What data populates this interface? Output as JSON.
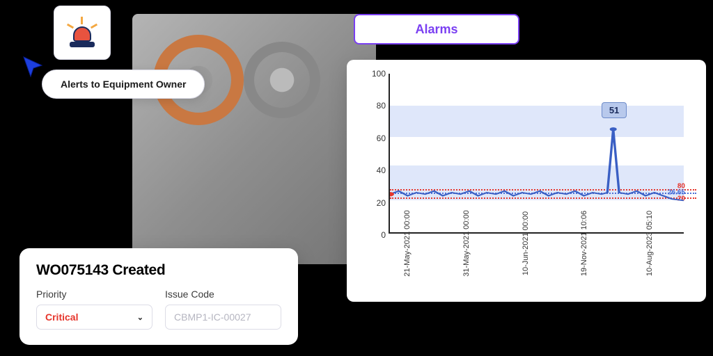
{
  "alerts_pill": "Alerts to Equipment Owner",
  "work_order": {
    "title": "WO075143 Created",
    "priority_label": "Priority",
    "priority_value": "Critical",
    "issue_code_label": "Issue Code",
    "issue_code_value": "CBMP1-IC-00027"
  },
  "alarms_title": "Alarms",
  "chart_data": {
    "type": "line",
    "ylim": [
      0,
      100
    ],
    "y_ticks": [
      0,
      20,
      40,
      60,
      80,
      100
    ],
    "x_labels": [
      "21-May-2021 00:00",
      "31-May-2021 00:00",
      "10-Jun-2021 00:00",
      "19-Nov-2021 10:06",
      "10-Aug-2023 05:10"
    ],
    "bands": [
      {
        "from": 60,
        "to": 80
      },
      {
        "from": 20,
        "to": 42
      }
    ],
    "guides": [
      {
        "label": "80",
        "value": 27,
        "color": "red"
      },
      {
        "label": "26.65",
        "value": 25,
        "color": "blue"
      },
      {
        "label": "20",
        "value": 22,
        "color": "red"
      }
    ],
    "spike": {
      "x_pct": 77,
      "value": 65,
      "label": "51"
    },
    "baseline_approx": 25
  }
}
